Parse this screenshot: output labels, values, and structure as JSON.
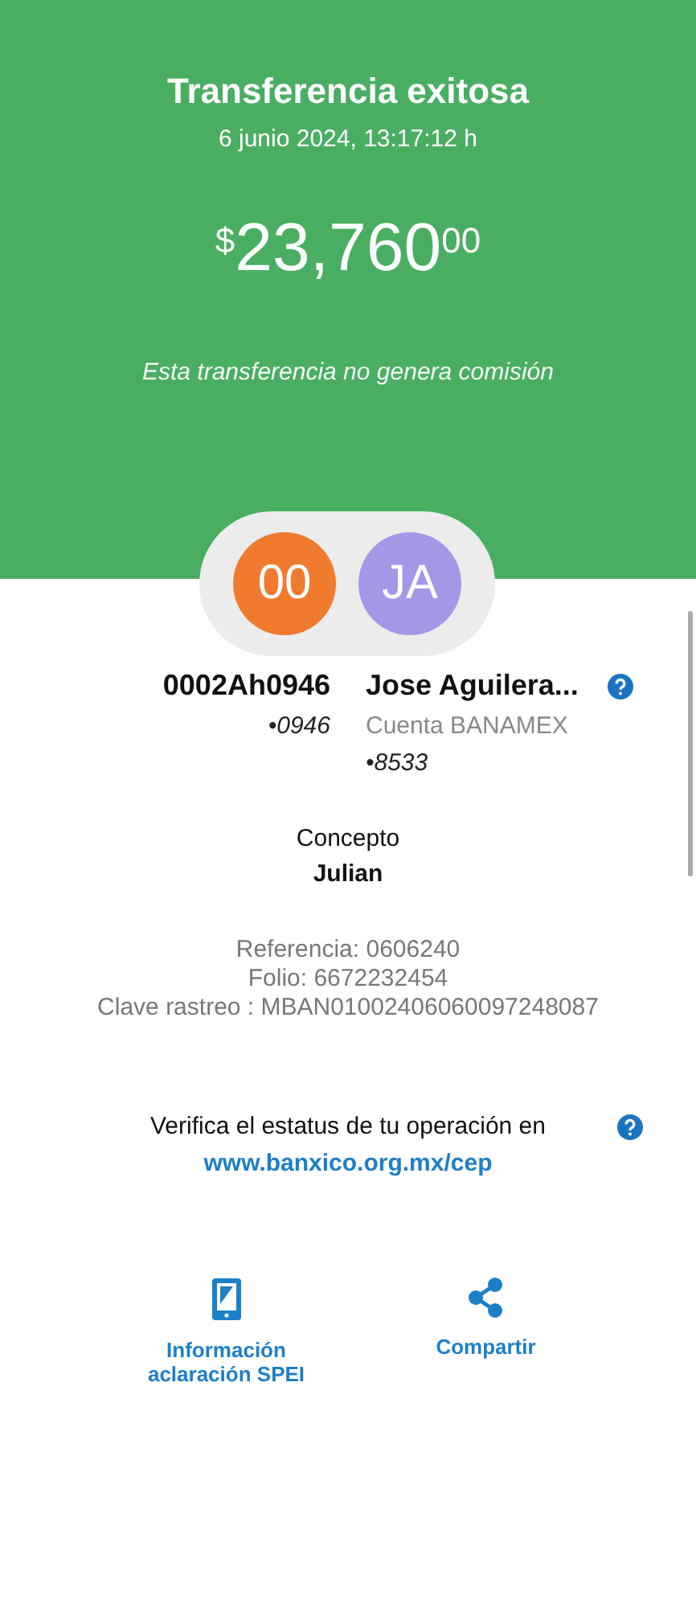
{
  "header": {
    "title": "Transferencia exitosa",
    "date": "6 junio 2024, 13:17:12 h",
    "amount": {
      "currency": "$",
      "integer": "23,760",
      "cents": "00"
    },
    "note": "Esta transferencia no genera comisión"
  },
  "parties": [
    {
      "initials": "00",
      "color": "#f07a2e",
      "name": "0002Ah0946",
      "lines": [
        "•0946"
      ],
      "help": false
    },
    {
      "initials": "JA",
      "color": "#a397e8",
      "name": "Jose Aguilera...",
      "lines": [
        "Cuenta BANAMEX",
        "•8533"
      ],
      "help": true
    }
  ],
  "concept": {
    "label": "Concepto",
    "value": "Julian"
  },
  "references": [
    "Referencia: 0606240",
    "Folio: 6672232454",
    "Clave rastreo : MBAN01002406060097248087"
  ],
  "verify": {
    "text": "Verifica el estatus de tu operación en",
    "link": "www.banxico.org.mx/cep"
  },
  "actions": [
    {
      "kind": "phone",
      "label": "Información aclaración SPEI"
    },
    {
      "kind": "share",
      "label": "Compartir"
    }
  ]
}
